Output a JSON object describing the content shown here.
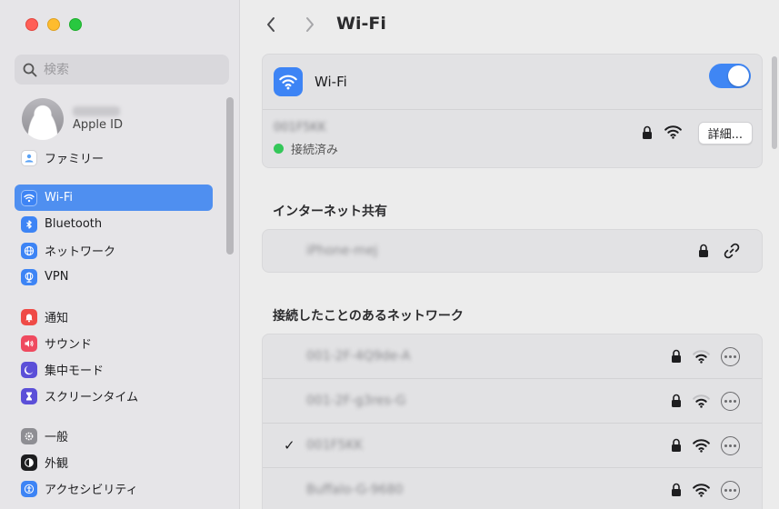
{
  "sidebar": {
    "search_placeholder": "検索",
    "apple_id": {
      "name_blurred": "●●●●●",
      "label": "Apple ID"
    },
    "family": "ファミリー",
    "group1": [
      {
        "label": "Wi-Fi",
        "icon": "wifi-icon",
        "active": true
      },
      {
        "label": "Bluetooth",
        "icon": "bluetooth-icon"
      },
      {
        "label": "ネットワーク",
        "icon": "globe-icon"
      },
      {
        "label": "VPN",
        "icon": "vpn-globe-icon"
      }
    ],
    "group2": [
      {
        "label": "通知",
        "icon": "bell-icon"
      },
      {
        "label": "サウンド",
        "icon": "speaker-icon"
      },
      {
        "label": "集中モード",
        "icon": "moon-icon"
      },
      {
        "label": "スクリーンタイム",
        "icon": "hourglass-icon"
      }
    ],
    "group3": [
      {
        "label": "一般",
        "icon": "gear-icon"
      },
      {
        "label": "外観",
        "icon": "appearance-icon"
      },
      {
        "label": "アクセシビリティ",
        "icon": "accessibility-icon"
      }
    ]
  },
  "header": {
    "title": "Wi-Fi"
  },
  "wifi": {
    "label": "Wi-Fi",
    "enabled": true,
    "current_network": "001F5KK",
    "status": "接続済み",
    "detail_button": "詳細..."
  },
  "hotspot": {
    "section_title": "インターネット共有",
    "network": "iPhone-mej"
  },
  "known": {
    "section_title": "接続したことのあるネットワーク",
    "networks": [
      {
        "name": "001-2F-4Q9de-A",
        "connected": false
      },
      {
        "name": "001-2F-g3res-G",
        "connected": false
      },
      {
        "name": "001F5KK",
        "connected": true
      },
      {
        "name": "Buffalo-G-9680",
        "connected": false
      }
    ],
    "check_mark": "✓"
  },
  "colors": {
    "accent": "#3f86f4",
    "selection": "#4f8ff0",
    "connected": "#34c759"
  }
}
